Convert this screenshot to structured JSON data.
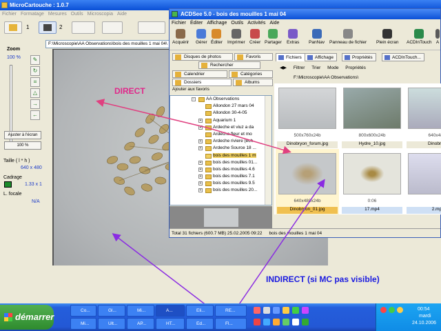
{
  "mc": {
    "title": "MicroCartouche : 1.0.7",
    "menu": [
      "Fichier",
      "Formatage",
      "Mesures",
      "Outils",
      "Microscopia",
      "Aide"
    ],
    "toolbar_num1": "1",
    "toolbar_num2": "2",
    "path": "F:\\Microscopie\\AA Observations\\bois des mouilles 1 mai 04\\",
    "zoom_label": "Zoom",
    "zoom_value": "100 %",
    "fit_button": "Ajuster à l'écran",
    "zoom_button": "100 %",
    "size_label": "Taille ( l * h )",
    "size_value": "640 x 480",
    "cadrage_label": "Cadrage",
    "cadrage_value": "1.33 x 1",
    "focal_label": "L. focale",
    "focal_value": "N/A"
  },
  "acd": {
    "title": "ACDSee 5.0 - bois des mouilles 1 mai 04",
    "menu": [
      "Fichier",
      "Éditer",
      "Affichage",
      "Outils",
      "Activités",
      "Aide"
    ],
    "toolbar": [
      "Acquérir",
      "Gérer",
      "Éditer",
      "Imprimer",
      "Créer",
      "Partager",
      "Extras",
      "PanNav",
      "Panneau de fichier",
      "Plein écran",
      "ACDInTouch",
      "A"
    ],
    "left_tabs": {
      "disques": "Disques de photos",
      "favoris": "Favoris",
      "rechercher": "Rechercher",
      "calendrier": "Calendrier",
      "categories": "Catégories",
      "dossiers": "Dossiers",
      "albums": "Albums"
    },
    "add_fav": "Ajouter aux favoris",
    "tree": [
      "AA Observations",
      "Allondon 27 mars 04",
      "Allondon 30-4-05",
      "Aquarium 1",
      "Ardeche et viuz a da",
      "Ardeche fleur et mo",
      "Ardeche riviere (ech",
      "Ardeche Source 18 ...",
      "bois des mouilles 1 m",
      "bois des mouilles 01...",
      "bois des mouilles 4.6",
      "bois des mouilles 7.1",
      "bois des mouilles 9.5",
      "bois des mouilles 20..."
    ],
    "right_tabs": [
      "Fichiers",
      "Affichage",
      "Propriétés",
      "ACDInTouch..."
    ],
    "right_tb": [
      "Filtrer",
      "Trier",
      "Mode",
      "Propriétés"
    ],
    "right_path": "F:\\Microscopie\\AA Observations\\",
    "thumbs": [
      {
        "cap": "500x760x24b",
        "name": "Dinobryon_forum.jpg"
      },
      {
        "cap": "800x600x24b",
        "name": "Hydre_10.jpg"
      },
      {
        "cap": "640x480",
        "name": "Dinobryo"
      },
      {
        "cap": "640x480x24b",
        "name": "Dinobryon_01.jpg"
      },
      {
        "cap": "0:06",
        "name": "17.mp4"
      },
      {
        "cap": "",
        "name": "2.mp"
      }
    ],
    "status": "Total 31 fichiers (600.7 MB)   25.02.2005 09:22",
    "status_folder": "bois des mouilles 1 mai 04"
  },
  "annotations": {
    "direct": "DIRECT",
    "indirect": "INDIRECT (si MC pas visible)"
  },
  "taskbar": {
    "start": "démarrer",
    "items": [
      "Co...",
      "Gl...",
      "Mi...",
      "A...",
      "Eli...",
      "RE...",
      "Mi...",
      "Ult...",
      "AP...",
      "HT...",
      "Ed...",
      "Fl..."
    ],
    "time": "00:54",
    "day": "mardi",
    "date": "24.10.2006"
  }
}
